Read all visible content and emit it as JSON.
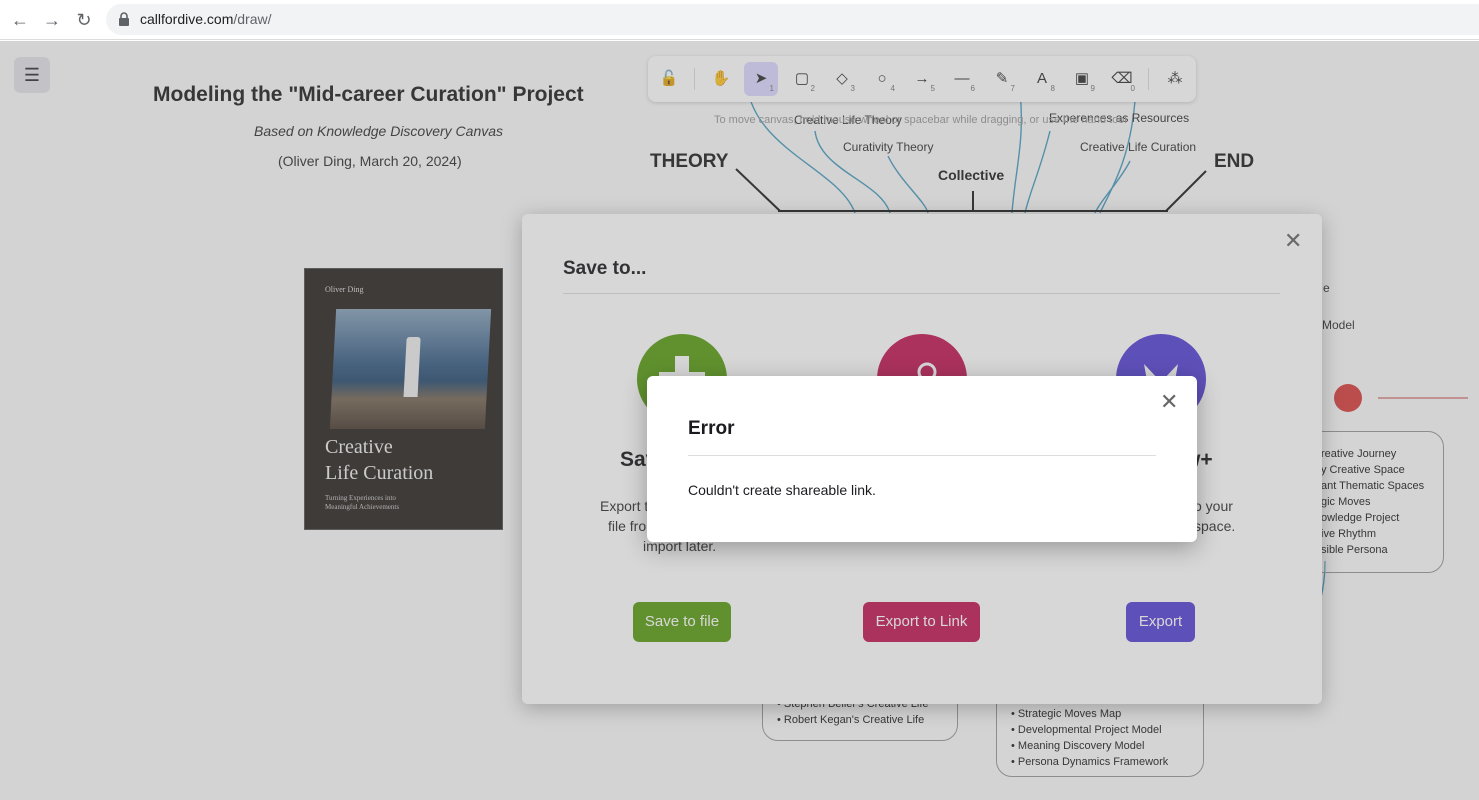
{
  "browser": {
    "url_host": "callfordive.com",
    "url_path": "/draw/"
  },
  "canvas": {
    "title": "Modeling the \"Mid-career Curation\" Project",
    "subtitle": "Based on Knowledge Discovery Canvas",
    "date": "(Oliver Ding, March 20, 2024)",
    "hint": "To move canvas, hold mouse wheel or spacebar while dragging, or use the hand tool",
    "labels": {
      "theory": "THEORY",
      "end": "END",
      "collective": "Collective",
      "creative_life_theory": "Creative Life Theory",
      "curativity_theory": "Curativity Theory",
      "experiences_as_resources": "Experences as Resources",
      "creative_life_curation": "Creative Life Curation",
      "frag_e": "e",
      "frag_model": "Model"
    },
    "book": {
      "author": "Oliver Ding",
      "title_line1": "Creative",
      "title_line2": "Life Curation",
      "subtitle_line1": "Turning Experiences into",
      "subtitle_line2": "Meaningful Achievements"
    },
    "right_list": [
      "reative Journey",
      "y Creative Space",
      "ant Thematic Spaces",
      "gic Moves",
      "owledge Project",
      "ive Rhythm",
      "sible Persona"
    ],
    "bottom_left_list": [
      "Stephen Beller's Creative Life",
      "Robert Kegan's Creative Life"
    ],
    "bottom_right_list": [
      "Strategic Moves Map",
      "Developmental Project Model",
      "Meaning Discovery Model",
      "Persona Dynamics Framework"
    ]
  },
  "toolbar": {
    "tools": [
      {
        "name": "lock-tool",
        "icon": "🔓",
        "key": ""
      },
      {
        "name": "hand-tool",
        "icon": "✋",
        "key": ""
      },
      {
        "name": "selection-tool",
        "icon": "➤",
        "key": "1"
      },
      {
        "name": "rectangle-tool",
        "icon": "▢",
        "key": "2"
      },
      {
        "name": "diamond-tool",
        "icon": "◇",
        "key": "3"
      },
      {
        "name": "ellipse-tool",
        "icon": "○",
        "key": "4"
      },
      {
        "name": "arrow-tool",
        "icon": "→",
        "key": "5"
      },
      {
        "name": "line-tool",
        "icon": "—",
        "key": "6"
      },
      {
        "name": "draw-tool",
        "icon": "✎",
        "key": "7"
      },
      {
        "name": "text-tool",
        "icon": "A",
        "key": "8"
      },
      {
        "name": "image-tool",
        "icon": "▣",
        "key": "9"
      },
      {
        "name": "eraser-tool",
        "icon": "⌫",
        "key": "0"
      },
      {
        "name": "library-tool",
        "icon": "⁂",
        "key": ""
      }
    ]
  },
  "save_dialog": {
    "title": "Save to...",
    "options": [
      {
        "head": "Sav",
        "desc_line1": "Export t",
        "desc_line2": "file fro",
        "desc_line3": "import later.",
        "button": "Save to file",
        "color": "#5a9e16"
      },
      {
        "head": "",
        "desc_line1": "",
        "desc_line2": "",
        "desc_line3": "",
        "button": "Export to Link",
        "color": "#c21b56"
      },
      {
        "head": "w+",
        "desc_line1": "o your",
        "desc_line2": "space.",
        "desc_line3": "",
        "button": "Export",
        "color": "#5845d6"
      }
    ]
  },
  "error_dialog": {
    "title": "Error",
    "message": "Couldn't create shareable link."
  },
  "colors": {
    "accent": "#6965db",
    "save_green": "#5a9e16",
    "link_pink": "#c21b56",
    "plus_purple": "#5845d6",
    "red_dot": "#d94040"
  }
}
